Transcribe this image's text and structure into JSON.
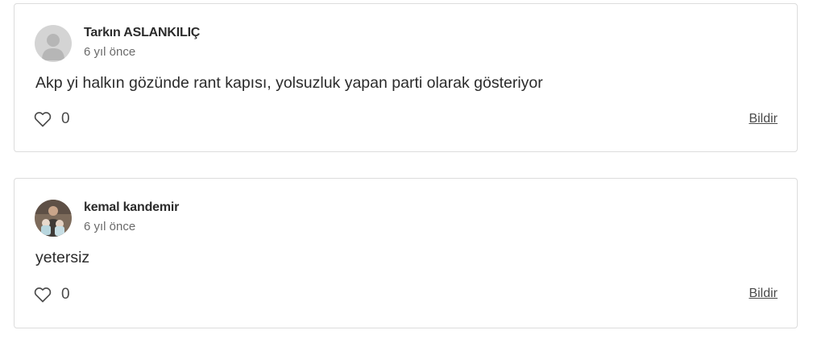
{
  "comments": [
    {
      "author": "Tarkın ASLANKILIÇ",
      "time": "6 yıl önce",
      "text": "Akp yi halkın gözünde rant kapısı, yolsuzluk yapan parti olarak gösteriyor",
      "likes": "0",
      "report_label": "Bildir",
      "avatar": "default-user-avatar"
    },
    {
      "author": "kemal kandemir",
      "time": "6 yıl önce",
      "text": "yetersiz",
      "likes": "0",
      "report_label": "Bildir",
      "avatar": "user-photo-avatar"
    }
  ],
  "colors": {
    "border": "#dcdcdc",
    "text": "#2b2b2b",
    "muted": "#6a6a6a",
    "avatar_bg": "#d4d4d4"
  },
  "icons": {
    "like": "heart-icon"
  }
}
